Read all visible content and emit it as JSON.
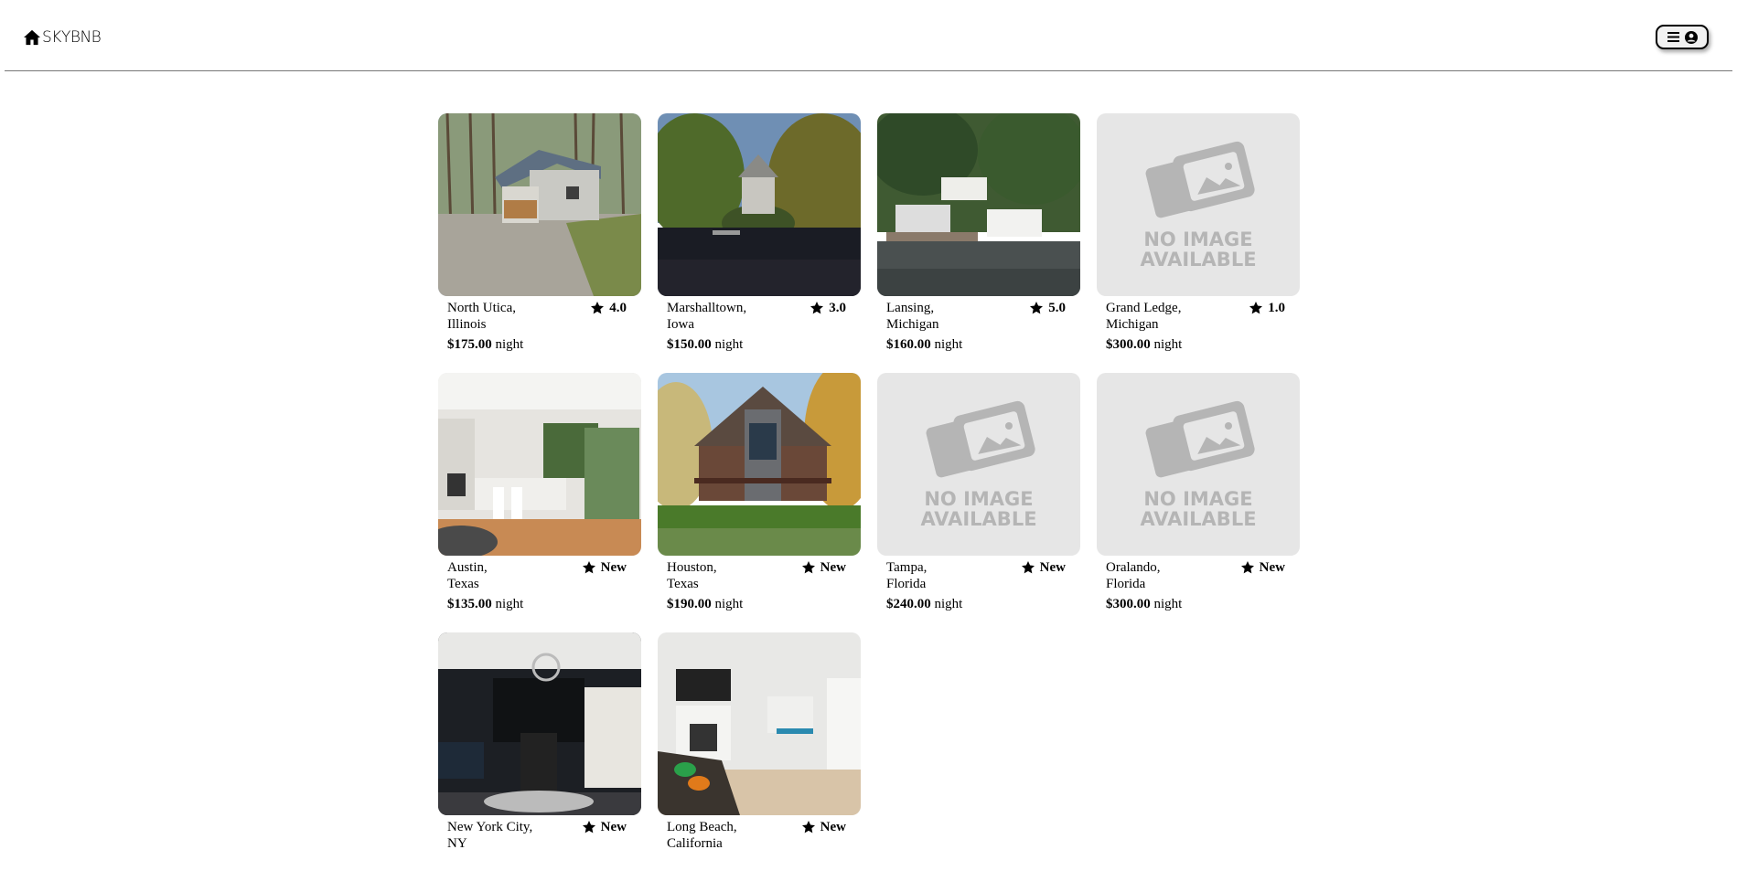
{
  "header": {
    "logo_text": "SKYBNB",
    "logo_icon": "home-icon",
    "menu_icons": [
      "menu-icon",
      "user-circle-icon"
    ]
  },
  "listings": [
    {
      "city": "North Utica,",
      "state": "Illinois",
      "rating": "4.0",
      "price": "$175.00",
      "unit": "night",
      "image": "cabin"
    },
    {
      "city": "Marshalltown,",
      "state": "Iowa",
      "rating": "3.0",
      "price": "$150.00",
      "unit": "night",
      "image": "lakehouse"
    },
    {
      "city": "Lansing,",
      "state": "Michigan",
      "rating": "5.0",
      "price": "$160.00",
      "unit": "night",
      "image": "boathouse"
    },
    {
      "city": "Grand Ledge,",
      "state": "Michigan",
      "rating": "1.0",
      "price": "$300.00",
      "unit": "night",
      "image": "none"
    },
    {
      "city": "Austin,",
      "state": "Texas",
      "rating": "New",
      "price": "$135.00",
      "unit": "night",
      "image": "kitchen"
    },
    {
      "city": "Houston,",
      "state": "Texas",
      "rating": "New",
      "price": "$190.00",
      "unit": "night",
      "image": "chalet"
    },
    {
      "city": "Tampa,",
      "state": "Florida",
      "rating": "New",
      "price": "$240.00",
      "unit": "night",
      "image": "none"
    },
    {
      "city": "Oralando,",
      "state": "Florida",
      "rating": "New",
      "price": "$300.00",
      "unit": "night",
      "image": "none"
    },
    {
      "city": "New York City,",
      "state": "NY",
      "rating": "New",
      "price": "",
      "unit": "",
      "image": "dining"
    },
    {
      "city": "Long Beach,",
      "state": "California",
      "rating": "New",
      "price": "",
      "unit": "",
      "image": "livingroom"
    }
  ],
  "placeholder": {
    "line1": "NO IMAGE",
    "line2": "AVAILABLE"
  },
  "colors": {
    "border": "#777777",
    "placeholder_bg": "#e6e6e6",
    "placeholder_fg": "#b5b5b5"
  }
}
